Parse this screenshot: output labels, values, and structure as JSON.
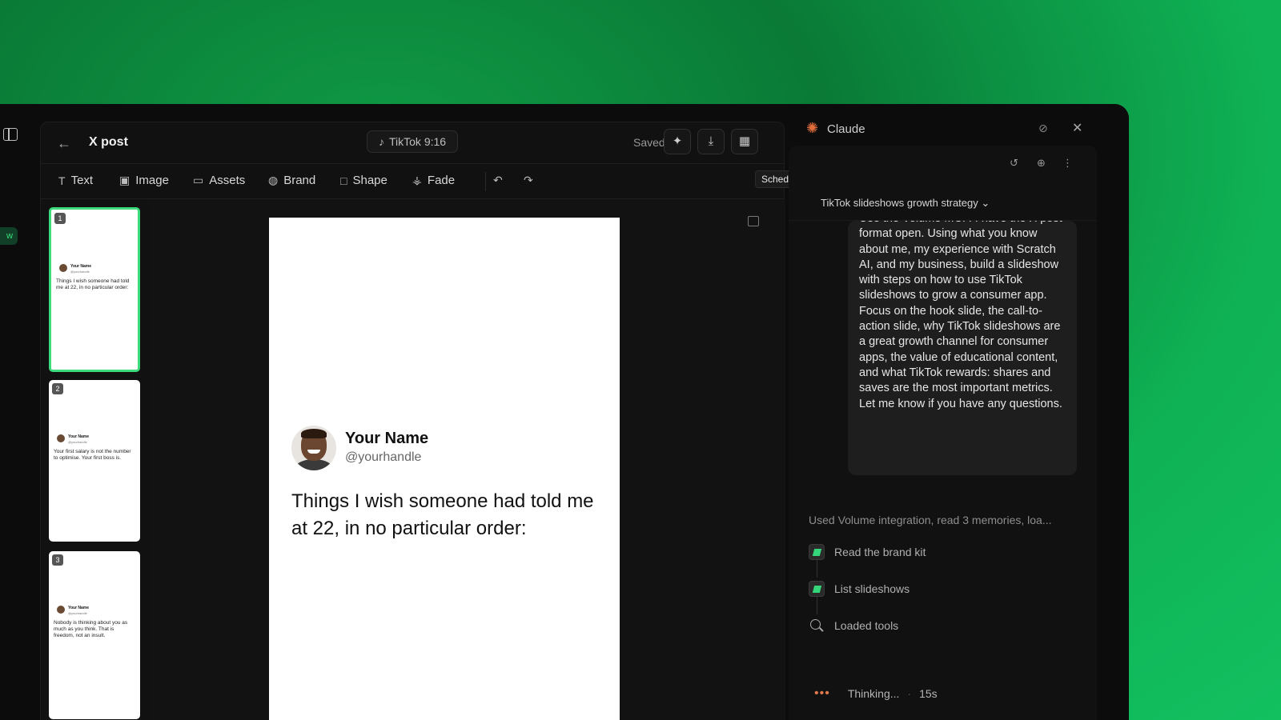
{
  "editor": {
    "title": "X post",
    "format": "TikTok 9:16",
    "saved": "Saved",
    "tooltip": "Schedule",
    "tools": {
      "text": "Text",
      "image": "Image",
      "assets": "Assets",
      "brand": "Brand",
      "shape": "Shape",
      "fade": "Fade"
    },
    "thumbnails": [
      {
        "num": "1",
        "name": "Your Name",
        "handle": "@yourhandle",
        "text": "Things I wish someone had told me at 22, in no particular order:"
      },
      {
        "num": "2",
        "name": "Your Name",
        "handle": "@yourhandle",
        "text": "Your first salary is not the number to optimise. Your first boss is."
      },
      {
        "num": "3",
        "name": "Your Name",
        "handle": "@yourhandle",
        "text": "Nobody is thinking about you as much as you think. That is freedom, not an insult."
      }
    ],
    "slide": {
      "name": "Your Name",
      "handle": "@yourhandle",
      "text": "Things I wish someone had told me at 22, in no particular order:"
    }
  },
  "left_rail": {
    "pill": "w"
  },
  "claude": {
    "title": "Claude",
    "conversation": "TikTok slideshows growth strategy",
    "message": "Use the Volume MCP. I have the X post format open. Using what you know about me, my experience with Scratch AI, and my business, build a slideshow with steps on how to use TikTok slideshows to grow a consumer app. Focus on the hook slide, the call-to-action slide, why TikTok slideshows are a great growth channel for consumer apps, the value of educational content, and what TikTok rewards: shares and saves are the most important metrics. Let me know if you have any questions.",
    "used": "Used Volume integration, read 3 memories, loa...",
    "steps": [
      "Read the brand kit",
      "List slideshows",
      "Loaded tools"
    ],
    "thinking": "Thinking...",
    "elapsed": "15s"
  }
}
